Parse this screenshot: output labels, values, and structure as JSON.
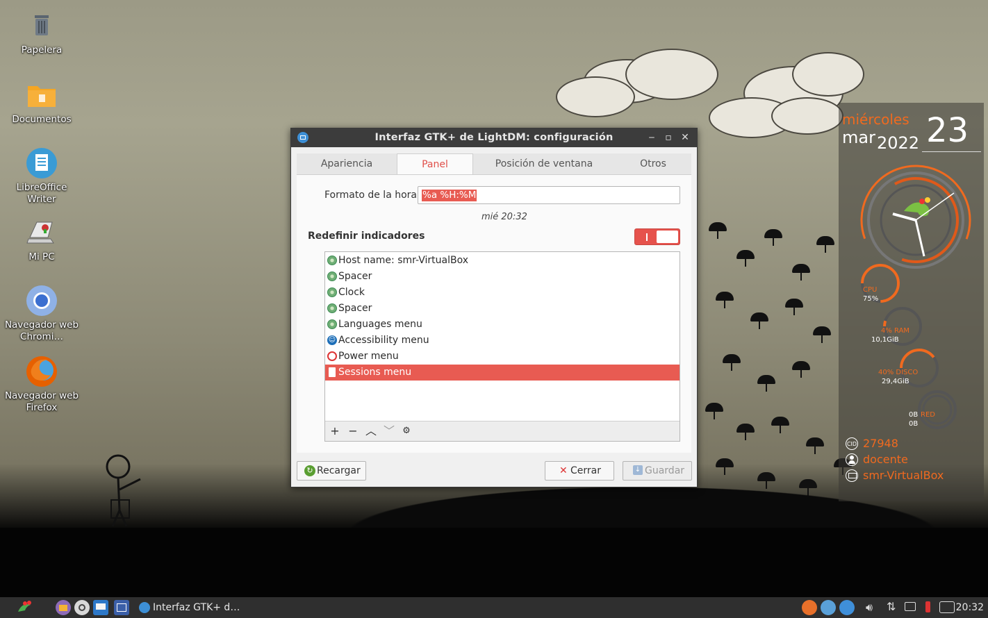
{
  "desktop": {
    "icons": [
      {
        "label": "Papelera",
        "icon": "trash-icon"
      },
      {
        "label": "Documentos",
        "icon": "folder-icon"
      },
      {
        "label": "LibreOffice Writer",
        "icon": "writer-icon"
      },
      {
        "label": "Mi PC",
        "icon": "computer-icon"
      },
      {
        "label": "Navegador web Chromi…",
        "icon": "chromium-icon"
      },
      {
        "label": "Navegador web Firefox",
        "icon": "firefox-icon"
      }
    ]
  },
  "conky": {
    "weekday": "miércoles",
    "month": "mar",
    "year": "2022",
    "day": "23",
    "cpu_label": "CPU",
    "cpu_value": "75%",
    "cpu_fraction": 0.75,
    "ram_label": "4% RAM",
    "ram_value": "10,1GiB",
    "disk_label": "40% DISCO",
    "disk_value": "29,4GiB",
    "net_down": "0B",
    "net_label": "RED",
    "net_up": "0B",
    "cid": "27948",
    "user": "docente",
    "host": "smr-VirtualBox",
    "accent": "#f06a1f"
  },
  "dialog": {
    "title": "Interfaz GTK+ de LightDM: configuración",
    "tabs": [
      "Apariencia",
      "Panel",
      "Posición de ventana",
      "Otros"
    ],
    "active_tab": "Panel",
    "time_format_label": "Formato de la hora",
    "time_format_value": "%a %H:%M",
    "time_preview": "mié 20:32",
    "indicators_label": "Redefinir indicadores",
    "indicators_enabled": true,
    "indicators": [
      {
        "label": "Host name: smr-VirtualBox",
        "icon": "indicator-icon"
      },
      {
        "label": "Spacer",
        "icon": "indicator-icon"
      },
      {
        "label": "Clock",
        "icon": "indicator-icon"
      },
      {
        "label": "Spacer",
        "icon": "indicator-icon"
      },
      {
        "label": "Languages menu",
        "icon": "indicator-icon"
      },
      {
        "label": "Accessibility menu",
        "icon": "accessibility-icon"
      },
      {
        "label": "Power menu",
        "icon": "power-icon"
      },
      {
        "label": "Sessions menu",
        "icon": "document-icon",
        "selected": true
      }
    ],
    "tools": [
      "+",
      "−",
      "︿",
      "﹀",
      "⚙"
    ],
    "reload_label": "Recargar",
    "close_label": "Cerrar",
    "save_label": "Guardar",
    "accent": "#e85b52"
  },
  "taskbar": {
    "window_item": "Interfaz GTK+ d…",
    "clock": "20:32"
  }
}
